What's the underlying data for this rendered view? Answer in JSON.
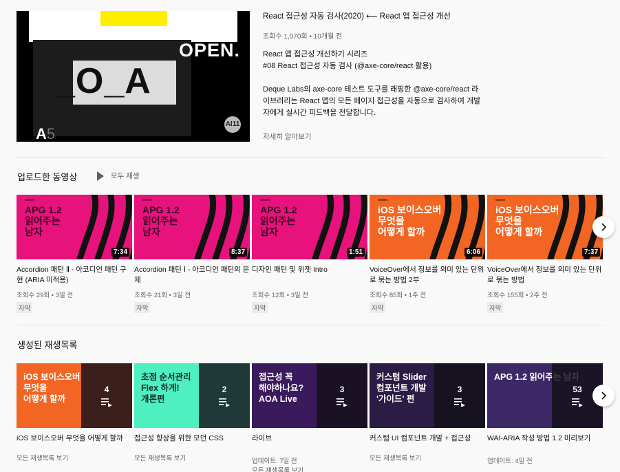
{
  "featured": {
    "thumb_open": "OPEN.",
    "thumb_aoa": "_O_A",
    "thumb_a": "A",
    "thumb_5": "5",
    "thumb_badge": "AI11",
    "title": "React 접근성 자동 검사(2020) ⟵ React 앱 접근성 개선",
    "meta": "조회수 1,070회 • 10개월 전",
    "description": "React 앱 접근성 개선하기 시리즈\n#08 React 접근성 자동 검사 (@axe-core/react 활용)\n\nDeque Labs의 axe-core 테스트 도구를 래핑한 @axe-core/react 라이브러리는 React 앱의 모든 페이지 접근성을 자동으로 검사하여 개발자에게 실시간 피드백을 전달합니다.\n\n피드백을 확인하고 문제를 해결함으로 잠재적인 접근성 문제를",
    "more": "자세히 알아보기"
  },
  "uploads": {
    "title": "업로드한 동영상",
    "play_all": "모두 재생",
    "videos": [
      {
        "thumb_text": "APG 1.2\n읽어주는\n남자",
        "duration": "7:34",
        "title": "Accordion 패턴 Ⅱ - 아코디언 패턴 구현 (ARIA 미적용)",
        "meta": "조회수 29회 • 3일 전",
        "badge": "자막",
        "color": "pink"
      },
      {
        "thumb_text": "APG 1.2\n읽어주는\n남자",
        "duration": "8:37",
        "title": "Accordion 패턴 Ⅰ - 아코디언 패턴의 문제",
        "meta": "조회수 21회 • 3일 전",
        "badge": "자막",
        "color": "pink"
      },
      {
        "thumb_text": "APG 1.2\n읽어주는\n남자",
        "duration": "1:51",
        "title": "디자인 패턴 및 위젯 Intro",
        "meta": "조회수 12회 • 3일 전",
        "badge": "자막",
        "color": "pink"
      },
      {
        "thumb_text": "iOS 보이스오버\n무엇을\n어떻게 할까",
        "duration": "6:06",
        "title": "VoiceOver에서 정보를 의미 있는 단위로 묶는 방법 2부",
        "meta": "조회수 85회 • 1주 전",
        "badge": "자막",
        "color": "orange"
      },
      {
        "thumb_text": "iOS 보이스오버\n무엇을\n어떻게 할까",
        "duration": "7:37",
        "title": "VoiceOver에서 정보를 의미 있는 단위로 묶는 방법",
        "meta": "조회수 155회 • 2주 전",
        "badge": "자막",
        "color": "orange"
      }
    ]
  },
  "playlists": {
    "title": "생성된 재생목록",
    "items": [
      {
        "thumb_text": "iOS 보이스오버\n무엇을\n어떻게 할까",
        "count": "4",
        "title": "iOS 보이스오버 무엇을 어떻게 할까",
        "meta": "",
        "link": "모든 재생목록 보기",
        "bg": "#f26522",
        "fg": "#ffffff"
      },
      {
        "thumb_text": "초점 순서관리\nFlex 하게!\n개론편",
        "count": "2",
        "title": "접근성 향상을 위한 모던 CSS",
        "meta": "",
        "link": "모든 재생목록 보기",
        "bg": "#4ff0c0",
        "fg": "#10302a"
      },
      {
        "thumb_text": "접근성 꼭\n해야하나요?\nAOA Live",
        "count": "3",
        "title": "라이브",
        "meta": "업데이트: 7일 전",
        "link": "모든 재생목록 보기",
        "bg": "#3a1a5c",
        "fg": "#ffffff"
      },
      {
        "thumb_text": "커스텀 Slider\n컴포넌트 개발\n'가이드' 편",
        "count": "3",
        "title": "커스텀 UI 컴포넌트 개발 + 접근성",
        "meta": "",
        "link": "모든 재생목록 보기",
        "bg": "#2a1c44",
        "fg": "#ffffff"
      },
      {
        "thumb_text": "APG 1.2 읽어주는 남자",
        "count": "53",
        "title": "WAI-ARIA 작성 방법 1.2 미리보기",
        "meta": "업데이트: 4일 전",
        "link": "",
        "bg": "#3c2866",
        "fg": "#ffffff"
      }
    ]
  }
}
